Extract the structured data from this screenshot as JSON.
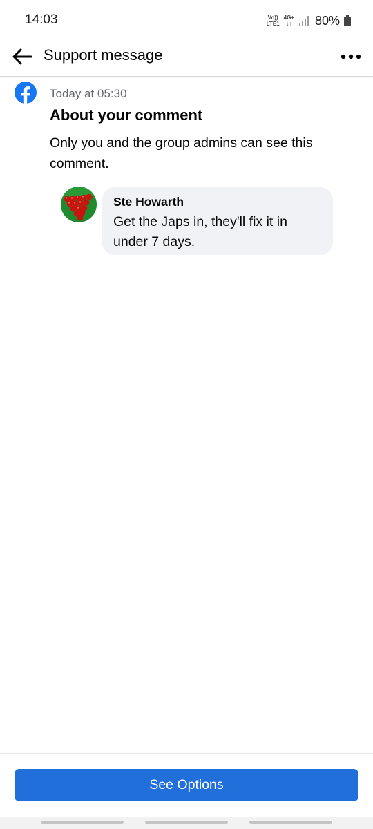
{
  "status_bar": {
    "time": "14:03",
    "volte_top": "Vo))",
    "volte_bottom": "LTE1",
    "network": "4G+",
    "battery": "80%"
  },
  "header": {
    "title": "Support message",
    "back_icon": "arrow-left-icon",
    "more_icon": "more-horizontal-icon"
  },
  "message": {
    "sender_icon": "facebook-icon",
    "timestamp": "Today at 05:30",
    "heading": "About your comment",
    "body": "Only you and the group admins can see this comment."
  },
  "comment": {
    "author": "Ste Howarth",
    "text": "Get the Japs in, they'll fix it in under 7 days."
  },
  "footer": {
    "button_label": "See Options"
  },
  "colors": {
    "facebook_blue": "#1877f2",
    "button_blue": "#216fdb",
    "bubble_bg": "#f0f2f5",
    "secondary_text": "#65676b"
  }
}
